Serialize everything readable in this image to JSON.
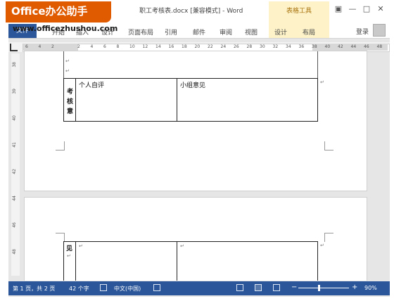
{
  "watermark": {
    "brand": "Office办公助手",
    "url": "www.officezhushou.com"
  },
  "titlebar": {
    "doc_title": "职工考核表.docx [兼容模式] - Word",
    "context_tools": "表格工具",
    "help": "?",
    "ribbon_display": "▣",
    "minimize": "—",
    "maximize": "□",
    "close": "✕"
  },
  "ribbon": {
    "file_tab": "文件",
    "tabs": [
      "开始",
      "插入",
      "设计",
      "页面布局",
      "引用",
      "邮件",
      "审阅",
      "视图",
      "设计",
      "布局"
    ],
    "signin": "登录"
  },
  "ruler": {
    "h_ticks": [
      "6",
      "4",
      "2",
      "",
      "2",
      "4",
      "6",
      "8",
      "10",
      "12",
      "14",
      "16",
      "18",
      "20",
      "22",
      "24",
      "26",
      "28",
      "30",
      "32",
      "34",
      "36",
      "38",
      "40",
      "42",
      "44",
      "46",
      "48"
    ],
    "v_ticks": [
      "38",
      "39",
      "40",
      "41",
      "42",
      "44",
      "46",
      "48"
    ]
  },
  "page1": {
    "side_label": "考核意",
    "cell_self": "个人自评",
    "cell_group": "小组意见",
    "mark": "↵"
  },
  "page2": {
    "side_label": "见",
    "mark": "↵"
  },
  "status": {
    "page": "第 1 页，共 2 页",
    "words": "42 个字",
    "language": "中文(中国)",
    "zoom": "90%",
    "zoom_minus": "−",
    "zoom_plus": "+"
  }
}
